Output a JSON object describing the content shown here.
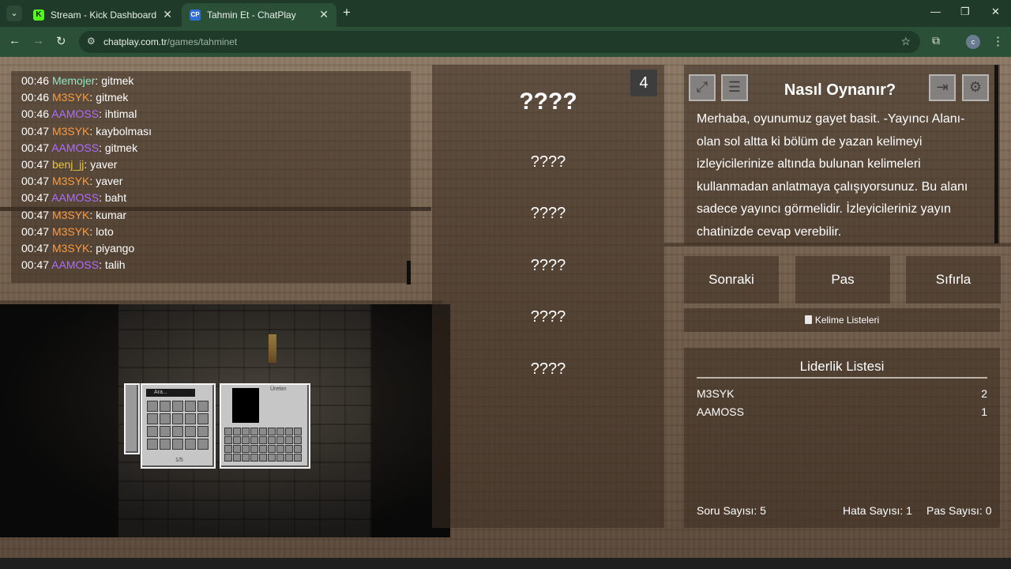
{
  "browser": {
    "tabs": [
      {
        "title": "Stream - Kick Dashboard",
        "favicon": "K",
        "active": false
      },
      {
        "title": "Tahmin Et - ChatPlay",
        "favicon": "CP",
        "active": true
      }
    ],
    "new_tab": "+",
    "url_host": "chatplay.com.tr",
    "url_path": "/games/tahminet",
    "profile_initial": "c",
    "window_controls": {
      "minimize": "—",
      "maximize": "❐",
      "close": "✕"
    }
  },
  "chat": {
    "messages": [
      {
        "time": "00:46",
        "user": "Memojer",
        "color": "#8fe6c2",
        "text": "gitmek"
      },
      {
        "time": "00:46",
        "user": "M3SYK",
        "color": "#ff9a3c",
        "text": "gitmek"
      },
      {
        "time": "00:46",
        "user": "AAMOSS",
        "color": "#b06bff",
        "text": "ihtimal"
      },
      {
        "time": "00:47",
        "user": "M3SYK",
        "color": "#ff9a3c",
        "text": "kaybolması"
      },
      {
        "time": "00:47",
        "user": "AAMOSS",
        "color": "#b06bff",
        "text": "gitmek"
      },
      {
        "time": "00:47",
        "user": "benj_jj",
        "color": "#e5c33b",
        "text": "yaver"
      },
      {
        "time": "00:47",
        "user": "M3SYK",
        "color": "#ff9a3c",
        "text": "yaver"
      },
      {
        "time": "00:47",
        "user": "AAMOSS",
        "color": "#b06bff",
        "text": "baht"
      },
      {
        "time": "00:47",
        "user": "M3SYK",
        "color": "#ff9a3c",
        "text": "kumar"
      },
      {
        "time": "00:47",
        "user": "M3SYK",
        "color": "#ff9a3c",
        "text": "loto"
      },
      {
        "time": "00:47",
        "user": "M3SYK",
        "color": "#ff9a3c",
        "text": "piyango"
      },
      {
        "time": "00:47",
        "user": "AAMOSS",
        "color": "#b06bff",
        "text": "talih"
      }
    ]
  },
  "words": {
    "counter": "4",
    "items": [
      "????",
      "????",
      "????",
      "????",
      "????",
      "????"
    ]
  },
  "howto": {
    "title": "Nasıl Oynanır?",
    "text": "Merhaba, oyunumuz gayet basit. -Yayıncı Alanı- olan sol altta ki bölüm de yazan kelimeyi izleyicilerinize altında bulunan kelimeleri kullanmadan anlatmaya çalışıyorsunuz. Bu alanı sadece yayıncı görmelidir. İzleyicileriniz yayın chatinizde cevap verebilir.",
    "icons": [
      "fullscreen-icon",
      "document-icon",
      "exit-icon",
      "gear-icon"
    ]
  },
  "actions": {
    "next": "Sonraki",
    "pass": "Pas",
    "reset": "Sıfırla"
  },
  "word_lists": "Kelime Listeleri",
  "leaderboard": {
    "title": "Liderlik Listesi",
    "rows": [
      {
        "name": "M3SYK",
        "score": "2"
      },
      {
        "name": "AAMOSS",
        "score": "1"
      }
    ],
    "question_count": "Soru Sayısı: 5",
    "error_count": "Hata Sayısı: 1",
    "pass_count": "Pas Sayısı: 0"
  },
  "game_ui": {
    "search_text": "Ara...",
    "crafting_label": "Üretim",
    "page_indicator": "1/5"
  }
}
